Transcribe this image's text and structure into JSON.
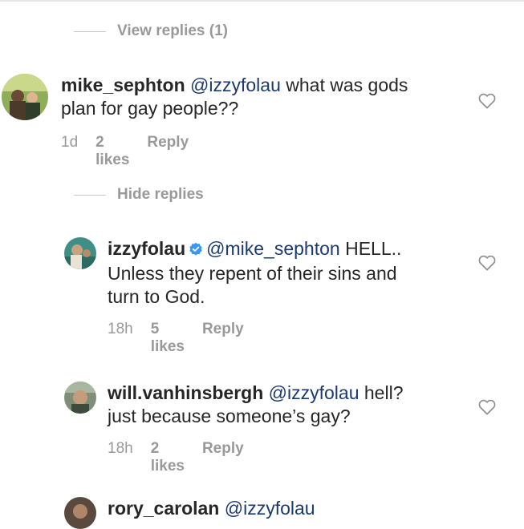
{
  "thread": {
    "view_replies_label": "View replies (1)",
    "hide_replies_label": "Hide replies"
  },
  "comments": [
    {
      "username": "mike_sephton",
      "mention": "@izzyfolau",
      "text_line1": " what was gods",
      "text_line2": "plan for gay people??",
      "time": "1d",
      "likes": "2 likes",
      "reply_label": "Reply"
    },
    {
      "username": "izzyfolau",
      "verified": true,
      "mention": "@mike_sephton",
      "text_line1": " HELL..",
      "text_line2": "Unless they repent of their sins and",
      "text_line3": "turn to God.",
      "time": "18h",
      "likes": "5 likes",
      "reply_label": "Reply"
    },
    {
      "username": "will.vanhinsbergh",
      "mention": "@izzyfolau",
      "text_line1": " hell?",
      "text_line2": "just because someone’s gay?",
      "time": "18h",
      "likes": "2 likes",
      "reply_label": "Reply"
    },
    {
      "username": "rory_carolan",
      "mention": "@izzyfolau"
    }
  ],
  "colors": {
    "mention": "#1b3b6f",
    "meta": "#999999",
    "verified": "#3897f0"
  },
  "icons": [
    "heart-icon",
    "verified-badge-icon"
  ]
}
